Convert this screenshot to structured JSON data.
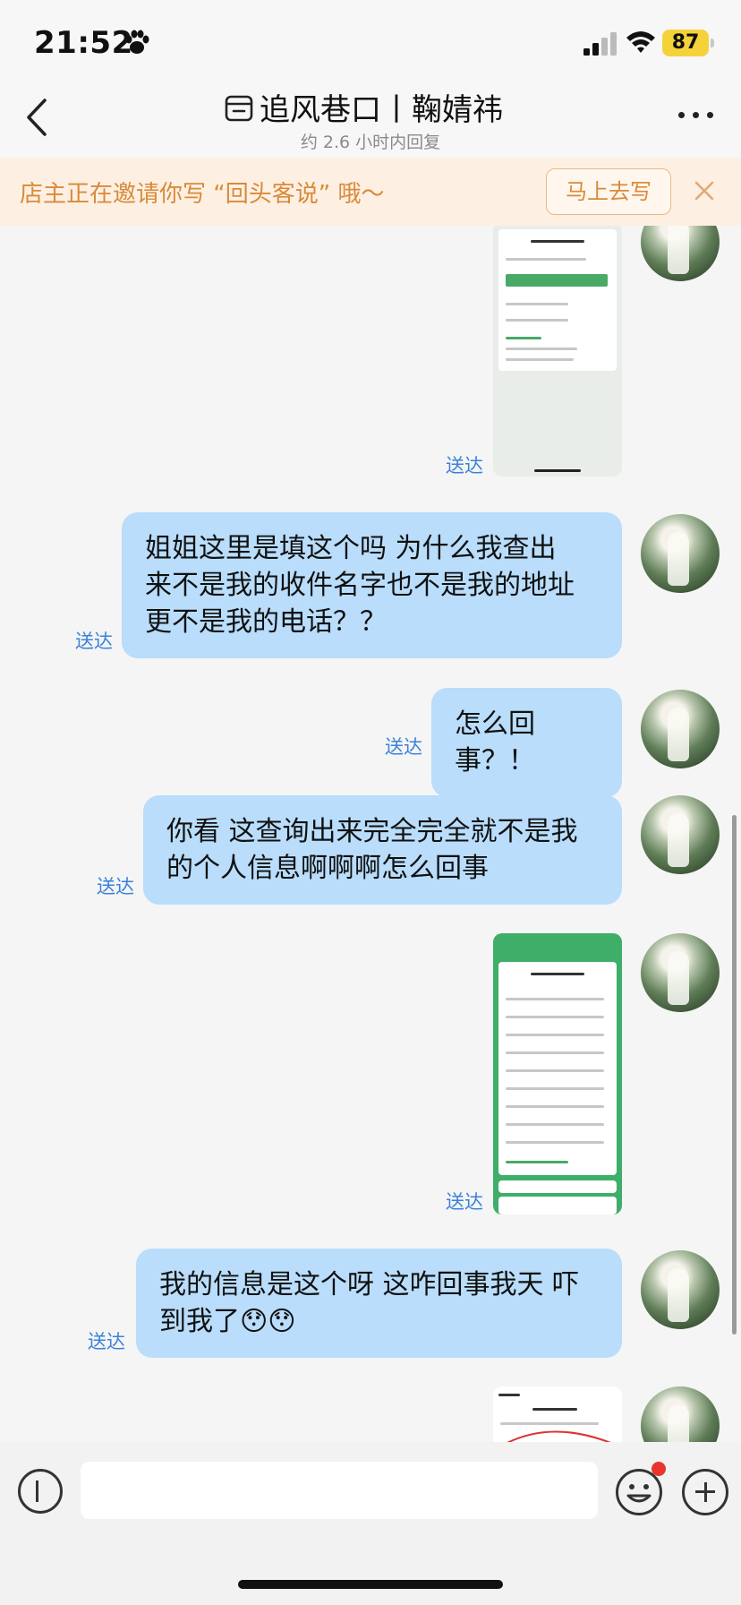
{
  "status_bar": {
    "time": "21:52",
    "battery": "87"
  },
  "header": {
    "title": "追风巷口丨鞠婧祎",
    "subtitle": "约 2.6 小时内回复"
  },
  "banner": {
    "text": "店主正在邀请你写 “回头客说” 哦～",
    "button": "马上去写"
  },
  "messages": [
    {
      "type": "image",
      "status": "送达"
    },
    {
      "type": "text",
      "text_lines": [
        "姐姐这里是填这个吗 为什么我查出",
        "来不是我的收件名字也不是我的地址",
        "更不是我的电话？？"
      ],
      "status": "送达"
    },
    {
      "type": "text",
      "text_lines": [
        "怎么回事？！"
      ],
      "status": "送达"
    },
    {
      "type": "text",
      "text_lines": [
        "你看 这查询出来完全完全就不是我",
        "的个人信息啊啊啊怎么回事"
      ],
      "status": "送达"
    },
    {
      "type": "image",
      "status": "送达"
    },
    {
      "type": "text",
      "text_lines": [
        "我的信息是这个呀 这咋回事我天 吓",
        "到我了😯😯"
      ],
      "status": "送达"
    },
    {
      "type": "image"
    }
  ],
  "composer": {
    "value": ""
  }
}
